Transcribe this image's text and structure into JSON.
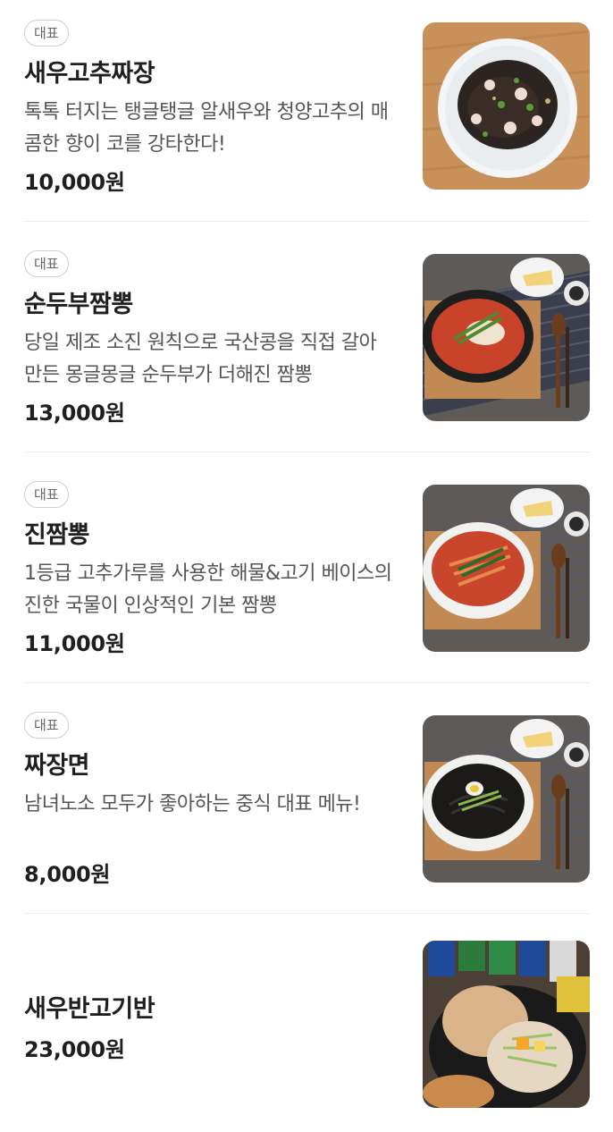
{
  "menu": {
    "items": [
      {
        "badge": "대표",
        "name": "새우고추짜장",
        "description": "톡톡 터지는 탱글탱글 알새우와 청양고추의 매콤한 향이 코를 강타한다!",
        "price": "10,000원"
      },
      {
        "badge": "대표",
        "name": "순두부짬뽕",
        "description": "당일 제조 소진 원칙으로 국산콩을 직접 갈아 만든 몽글몽글 순두부가 더해진 짬뽕",
        "price": "13,000원"
      },
      {
        "badge": "대표",
        "name": "진짬뽕",
        "description": "1등급 고추가루를 사용한 해물&고기 베이스의 진한 국물이 인상적인 기본 짬뽕",
        "price": "11,000원"
      },
      {
        "badge": "대표",
        "name": "짜장면",
        "description": "남녀노소 모두가 좋아하는 중식 대표 메뉴!",
        "price": "8,000원"
      },
      {
        "name": "새우반고기반",
        "price": "23,000원"
      }
    ]
  }
}
